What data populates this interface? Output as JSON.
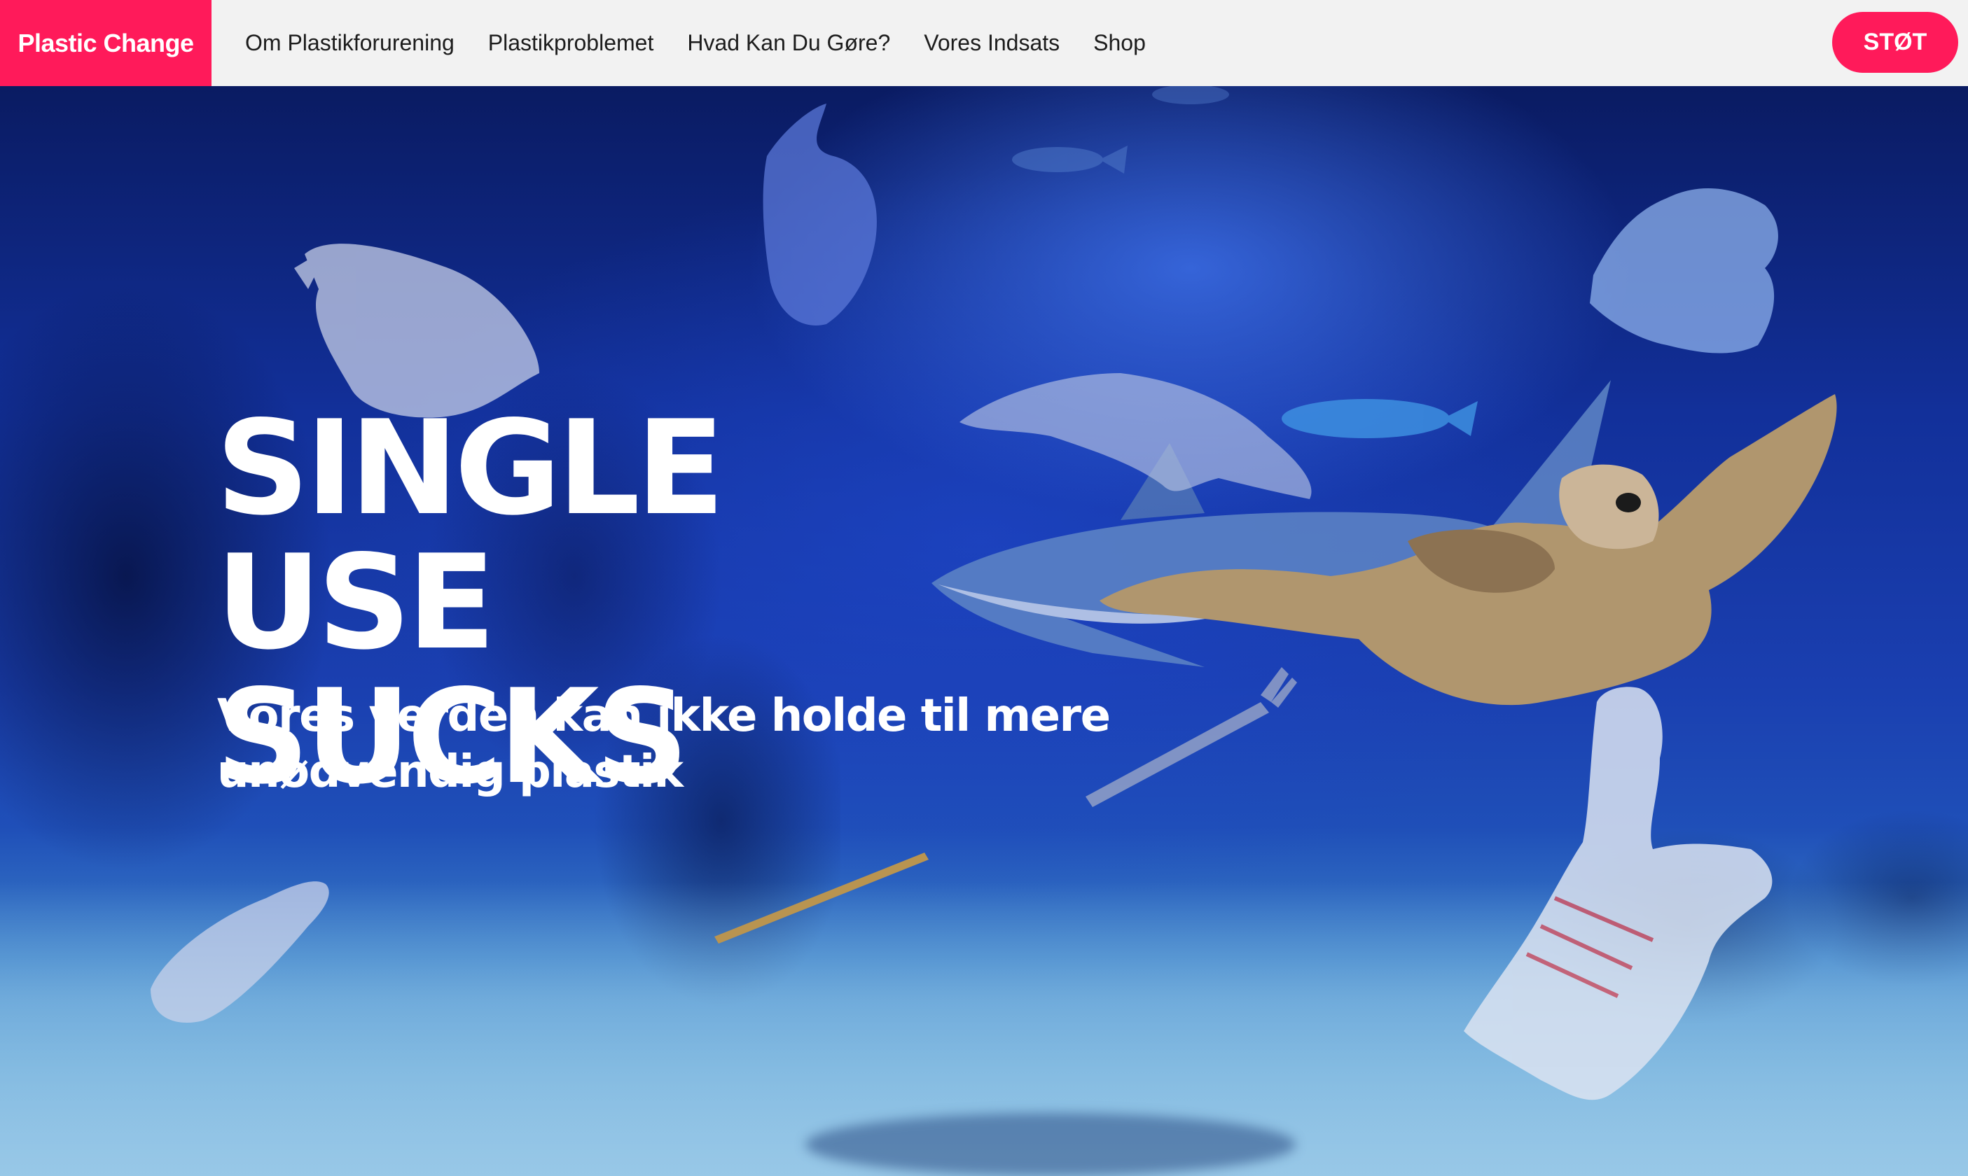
{
  "header": {
    "logo": "Plastic Change",
    "nav": [
      {
        "label": "Om Plastikforurening"
      },
      {
        "label": "Plastikproblemet"
      },
      {
        "label": "Hvad Kan Du Gøre?"
      },
      {
        "label": "Vores Indsats"
      },
      {
        "label": "Shop"
      }
    ],
    "donate_label": "STØT"
  },
  "hero": {
    "title_line1": "SINGLE USE",
    "title_line2": "SUCKS",
    "subtitle_line1": "Vores verden kan ikke holde til mere",
    "subtitle_line2": "unødvendig plastik",
    "scene": [
      "sea-turtle",
      "shark",
      "fish",
      "plastic-bag",
      "plastic-glove",
      "plastic-fork",
      "plastic-bottle",
      "plastic-straw",
      "shopping-bag"
    ]
  },
  "colors": {
    "brand": "#ff1a5a",
    "header_bg": "#f2f2f2",
    "nav_text": "#1c1c1c",
    "hero_text": "#ffffff",
    "ocean_deep": "#0a1b62",
    "ocean_mid": "#1a3fb0",
    "sand": "#9ec6e4"
  }
}
